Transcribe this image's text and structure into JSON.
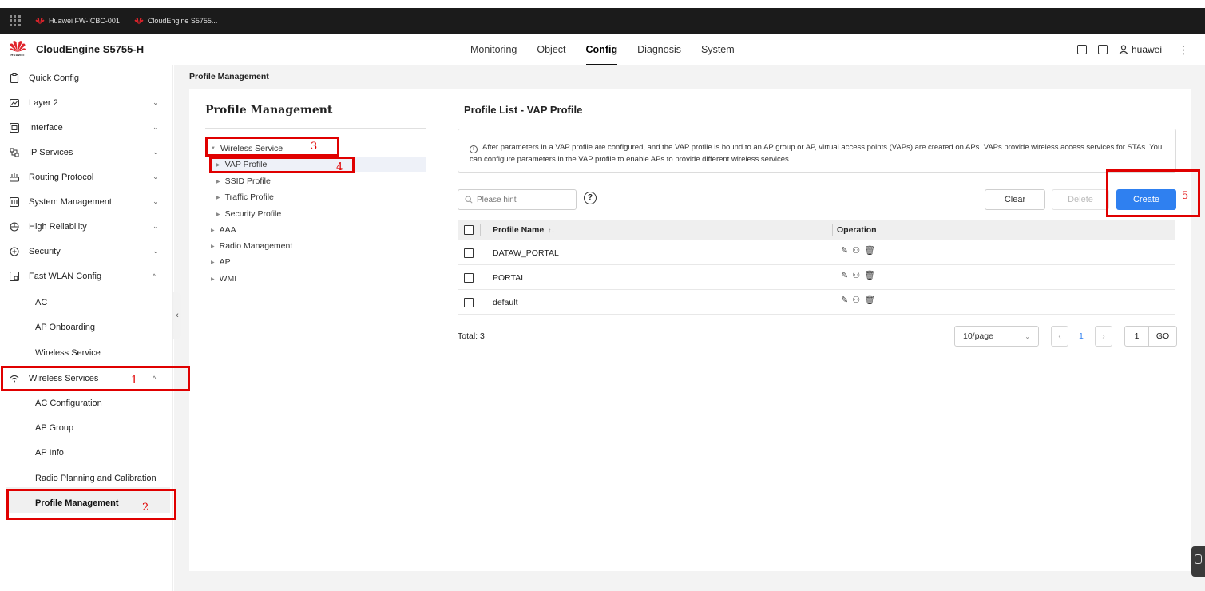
{
  "browser_tabs": [
    {
      "label": "Huawei FW-ICBC-001"
    },
    {
      "label": "CloudEngine S5755..."
    }
  ],
  "header": {
    "brand_word": "HUAWEI",
    "product_name": "CloudEngine S5755-H",
    "nav": [
      "Monitoring",
      "Object",
      "Config",
      "Diagnosis",
      "System"
    ],
    "active_nav": "Config",
    "username": "huawei",
    "more_glyph": "⋮"
  },
  "sidebar": {
    "items": [
      {
        "label": "Quick Config",
        "icon": "clipboard-icon",
        "chevron": ""
      },
      {
        "label": "Layer 2",
        "icon": "chart-icon",
        "chevron": "⌄"
      },
      {
        "label": "Interface",
        "icon": "interface-icon",
        "chevron": "⌄"
      },
      {
        "label": "IP Services",
        "icon": "network-icon",
        "chevron": "⌄"
      },
      {
        "label": "Routing Protocol",
        "icon": "router-icon",
        "chevron": "⌄"
      },
      {
        "label": "System Management",
        "icon": "system-icon",
        "chevron": "⌄"
      },
      {
        "label": "High Reliability",
        "icon": "reliability-icon",
        "chevron": "⌄"
      },
      {
        "label": "Security",
        "icon": "security-icon",
        "chevron": "⌄"
      },
      {
        "label": "Fast WLAN Config",
        "icon": "wlan-config-icon",
        "chevron": "^"
      }
    ],
    "fast_wlan_children": [
      "AC",
      "AP Onboarding",
      "Wireless Service"
    ],
    "wireless_services": {
      "label": "Wireless Services",
      "icon": "wifi-icon",
      "chevron": "^"
    },
    "wireless_children": [
      "AC Configuration",
      "AP Group",
      "AP Info",
      "Radio Planning and Calibration",
      "Profile Management"
    ],
    "collapse_glyph": "‹"
  },
  "breadcrumb": "Profile Management",
  "profile_tree": {
    "title": "Profile Management",
    "items": [
      {
        "label": "Wireless Service",
        "tri": "▼"
      },
      {
        "label": "VAP Profile",
        "tri": "▶"
      },
      {
        "label": "SSID Profile",
        "tri": "▶"
      },
      {
        "label": "Traffic Profile",
        "tri": "▶"
      },
      {
        "label": "Security Profile",
        "tri": "▶"
      },
      {
        "label": "AAA",
        "tri": "▶"
      },
      {
        "label": "Radio Management",
        "tri": "▶"
      },
      {
        "label": "AP",
        "tri": "▶"
      },
      {
        "label": "WMI",
        "tri": "▶"
      }
    ]
  },
  "list": {
    "title": "Profile List - VAP Profile",
    "info_glyph": "i",
    "info_text": "After parameters in a VAP profile are configured, and the VAP profile is bound to an AP group or AP, virtual access points (VAPs) are created on APs. VAPs provide wireless access services for STAs. You can configure parameters in the VAP profile to enable APs to provide different wireless services.",
    "search_placeholder": "Please hint",
    "help_glyph": "?",
    "buttons": {
      "clear": "Clear",
      "delete": "Delete",
      "create": "Create"
    },
    "columns": {
      "name": "Profile Name",
      "sort_glyph": "↑↓",
      "operation": "Operation"
    },
    "rows": [
      "DATAW_PORTAL",
      "PORTAL",
      "default"
    ],
    "op_glyphs": {
      "edit": "✎",
      "bind": "⚇",
      "delete": "🗑"
    },
    "total": "Total: 3",
    "page_size": "10/page",
    "page_size_chevron": "⌄",
    "prev_glyph": "‹",
    "next_glyph": "›",
    "current_page": "1",
    "goto_value": "1",
    "go_label": "GO"
  },
  "annotations": [
    "1",
    "2",
    "3",
    "4",
    "5"
  ],
  "colors": {
    "accent": "#2f80f0",
    "annotation_red": "#e00000"
  }
}
